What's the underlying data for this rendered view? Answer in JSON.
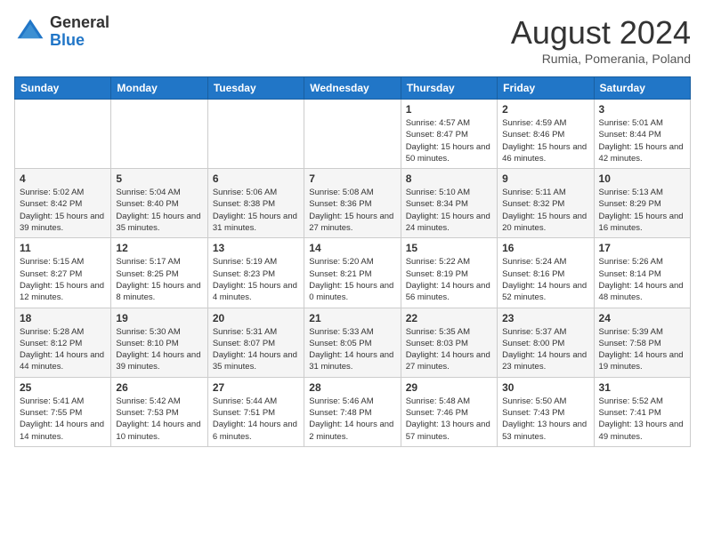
{
  "header": {
    "logo_general": "General",
    "logo_blue": "Blue",
    "month_year": "August 2024",
    "location": "Rumia, Pomerania, Poland"
  },
  "days_of_week": [
    "Sunday",
    "Monday",
    "Tuesday",
    "Wednesday",
    "Thursday",
    "Friday",
    "Saturday"
  ],
  "weeks": [
    [
      {
        "day": "",
        "sunrise": "",
        "sunset": "",
        "daylight": ""
      },
      {
        "day": "",
        "sunrise": "",
        "sunset": "",
        "daylight": ""
      },
      {
        "day": "",
        "sunrise": "",
        "sunset": "",
        "daylight": ""
      },
      {
        "day": "",
        "sunrise": "",
        "sunset": "",
        "daylight": ""
      },
      {
        "day": "1",
        "sunrise": "Sunrise: 4:57 AM",
        "sunset": "Sunset: 8:47 PM",
        "daylight": "Daylight: 15 hours and 50 minutes."
      },
      {
        "day": "2",
        "sunrise": "Sunrise: 4:59 AM",
        "sunset": "Sunset: 8:46 PM",
        "daylight": "Daylight: 15 hours and 46 minutes."
      },
      {
        "day": "3",
        "sunrise": "Sunrise: 5:01 AM",
        "sunset": "Sunset: 8:44 PM",
        "daylight": "Daylight: 15 hours and 42 minutes."
      }
    ],
    [
      {
        "day": "4",
        "sunrise": "Sunrise: 5:02 AM",
        "sunset": "Sunset: 8:42 PM",
        "daylight": "Daylight: 15 hours and 39 minutes."
      },
      {
        "day": "5",
        "sunrise": "Sunrise: 5:04 AM",
        "sunset": "Sunset: 8:40 PM",
        "daylight": "Daylight: 15 hours and 35 minutes."
      },
      {
        "day": "6",
        "sunrise": "Sunrise: 5:06 AM",
        "sunset": "Sunset: 8:38 PM",
        "daylight": "Daylight: 15 hours and 31 minutes."
      },
      {
        "day": "7",
        "sunrise": "Sunrise: 5:08 AM",
        "sunset": "Sunset: 8:36 PM",
        "daylight": "Daylight: 15 hours and 27 minutes."
      },
      {
        "day": "8",
        "sunrise": "Sunrise: 5:10 AM",
        "sunset": "Sunset: 8:34 PM",
        "daylight": "Daylight: 15 hours and 24 minutes."
      },
      {
        "day": "9",
        "sunrise": "Sunrise: 5:11 AM",
        "sunset": "Sunset: 8:32 PM",
        "daylight": "Daylight: 15 hours and 20 minutes."
      },
      {
        "day": "10",
        "sunrise": "Sunrise: 5:13 AM",
        "sunset": "Sunset: 8:29 PM",
        "daylight": "Daylight: 15 hours and 16 minutes."
      }
    ],
    [
      {
        "day": "11",
        "sunrise": "Sunrise: 5:15 AM",
        "sunset": "Sunset: 8:27 PM",
        "daylight": "Daylight: 15 hours and 12 minutes."
      },
      {
        "day": "12",
        "sunrise": "Sunrise: 5:17 AM",
        "sunset": "Sunset: 8:25 PM",
        "daylight": "Daylight: 15 hours and 8 minutes."
      },
      {
        "day": "13",
        "sunrise": "Sunrise: 5:19 AM",
        "sunset": "Sunset: 8:23 PM",
        "daylight": "Daylight: 15 hours and 4 minutes."
      },
      {
        "day": "14",
        "sunrise": "Sunrise: 5:20 AM",
        "sunset": "Sunset: 8:21 PM",
        "daylight": "Daylight: 15 hours and 0 minutes."
      },
      {
        "day": "15",
        "sunrise": "Sunrise: 5:22 AM",
        "sunset": "Sunset: 8:19 PM",
        "daylight": "Daylight: 14 hours and 56 minutes."
      },
      {
        "day": "16",
        "sunrise": "Sunrise: 5:24 AM",
        "sunset": "Sunset: 8:16 PM",
        "daylight": "Daylight: 14 hours and 52 minutes."
      },
      {
        "day": "17",
        "sunrise": "Sunrise: 5:26 AM",
        "sunset": "Sunset: 8:14 PM",
        "daylight": "Daylight: 14 hours and 48 minutes."
      }
    ],
    [
      {
        "day": "18",
        "sunrise": "Sunrise: 5:28 AM",
        "sunset": "Sunset: 8:12 PM",
        "daylight": "Daylight: 14 hours and 44 minutes."
      },
      {
        "day": "19",
        "sunrise": "Sunrise: 5:30 AM",
        "sunset": "Sunset: 8:10 PM",
        "daylight": "Daylight: 14 hours and 39 minutes."
      },
      {
        "day": "20",
        "sunrise": "Sunrise: 5:31 AM",
        "sunset": "Sunset: 8:07 PM",
        "daylight": "Daylight: 14 hours and 35 minutes."
      },
      {
        "day": "21",
        "sunrise": "Sunrise: 5:33 AM",
        "sunset": "Sunset: 8:05 PM",
        "daylight": "Daylight: 14 hours and 31 minutes."
      },
      {
        "day": "22",
        "sunrise": "Sunrise: 5:35 AM",
        "sunset": "Sunset: 8:03 PM",
        "daylight": "Daylight: 14 hours and 27 minutes."
      },
      {
        "day": "23",
        "sunrise": "Sunrise: 5:37 AM",
        "sunset": "Sunset: 8:00 PM",
        "daylight": "Daylight: 14 hours and 23 minutes."
      },
      {
        "day": "24",
        "sunrise": "Sunrise: 5:39 AM",
        "sunset": "Sunset: 7:58 PM",
        "daylight": "Daylight: 14 hours and 19 minutes."
      }
    ],
    [
      {
        "day": "25",
        "sunrise": "Sunrise: 5:41 AM",
        "sunset": "Sunset: 7:55 PM",
        "daylight": "Daylight: 14 hours and 14 minutes."
      },
      {
        "day": "26",
        "sunrise": "Sunrise: 5:42 AM",
        "sunset": "Sunset: 7:53 PM",
        "daylight": "Daylight: 14 hours and 10 minutes."
      },
      {
        "day": "27",
        "sunrise": "Sunrise: 5:44 AM",
        "sunset": "Sunset: 7:51 PM",
        "daylight": "Daylight: 14 hours and 6 minutes."
      },
      {
        "day": "28",
        "sunrise": "Sunrise: 5:46 AM",
        "sunset": "Sunset: 7:48 PM",
        "daylight": "Daylight: 14 hours and 2 minutes."
      },
      {
        "day": "29",
        "sunrise": "Sunrise: 5:48 AM",
        "sunset": "Sunset: 7:46 PM",
        "daylight": "Daylight: 13 hours and 57 minutes."
      },
      {
        "day": "30",
        "sunrise": "Sunrise: 5:50 AM",
        "sunset": "Sunset: 7:43 PM",
        "daylight": "Daylight: 13 hours and 53 minutes."
      },
      {
        "day": "31",
        "sunrise": "Sunrise: 5:52 AM",
        "sunset": "Sunset: 7:41 PM",
        "daylight": "Daylight: 13 hours and 49 minutes."
      }
    ]
  ]
}
